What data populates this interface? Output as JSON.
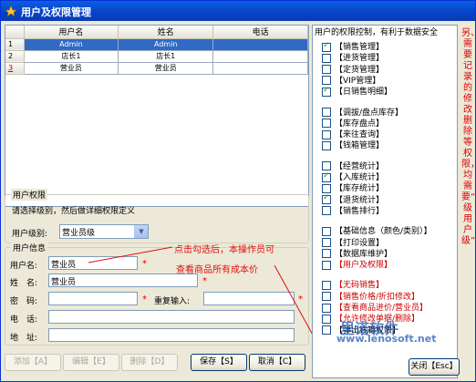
{
  "window": {
    "title": "用户及权限管理"
  },
  "grid": {
    "headers": [
      "用户名",
      "姓名",
      "电话"
    ],
    "rows": [
      {
        "num": "1",
        "username": "Admin",
        "name": "Admin",
        "phone": ""
      },
      {
        "num": "2",
        "username": "店长1",
        "name": "店长1",
        "phone": ""
      },
      {
        "num": "3",
        "username": "营业员",
        "name": "营业员",
        "phone": ""
      }
    ]
  },
  "perm_group": {
    "title": "用户权限",
    "hint": "请选择级别，然后做详细权限定义",
    "level_label": "用户级别:",
    "level_value": "营业员级"
  },
  "info_group": {
    "title": "用户信息",
    "username_label": "用户名:",
    "username_value": "营业员",
    "name_label": "姓　名:",
    "name_value": "营业员",
    "password_label": "密　码:",
    "password_value": "",
    "repeat_label": "重复输入:",
    "repeat_value": "",
    "phone_label": "电　话:",
    "phone_value": "",
    "address_label": "地　址:",
    "address_value": ""
  },
  "required_mark": "*",
  "annotation": {
    "line1": "点击勾选后，本操作员可",
    "line2": "查看商品所有成本价"
  },
  "buttons": {
    "add": "添加【A】",
    "edit": "编辑【E】",
    "delete": "删除【D】",
    "save": "保存【S】",
    "cancel": "取消【C】",
    "close": "关闭【Esc】"
  },
  "permissions": {
    "title": "用户的权限控制，有利于数据安全",
    "items": [
      {
        "label": "【销售管理】",
        "checked": true,
        "red": false
      },
      {
        "label": "【进货管理】",
        "checked": false,
        "red": false
      },
      {
        "label": "【定货管理】",
        "checked": false,
        "red": false
      },
      {
        "label": "【VIP管理】",
        "checked": false,
        "red": false
      },
      {
        "label": "【日销售明细】",
        "checked": true,
        "red": false
      },
      {
        "label": "【调拔/盘点库存】",
        "checked": false,
        "red": false
      },
      {
        "label": "【库存盘点】",
        "checked": false,
        "red": false
      },
      {
        "label": "【来往查询】",
        "checked": false,
        "red": false
      },
      {
        "label": "【钱箱管理】",
        "checked": false,
        "red": false
      },
      {
        "label": "【经营统计】",
        "checked": false,
        "red": false
      },
      {
        "label": "【入库统计】",
        "checked": true,
        "red": false
      },
      {
        "label": "【库存统计】",
        "checked": false,
        "red": false
      },
      {
        "label": "【退货统计】",
        "checked": true,
        "red": false
      },
      {
        "label": "【销售排行】",
        "checked": false,
        "red": false
      },
      {
        "label": "【基础信息（颜色/类别）】",
        "checked": false,
        "red": false
      },
      {
        "label": "【打印设置】",
        "checked": false,
        "red": false
      },
      {
        "label": "【数据库维护】",
        "checked": false,
        "red": false
      },
      {
        "label": "【用户及权限】",
        "checked": false,
        "red": true
      },
      {
        "label": "【无码销售】",
        "checked": false,
        "red": true
      },
      {
        "label": "【销售价格/折扣修改】",
        "checked": false,
        "red": true
      },
      {
        "label": "【查看商品进价/营业员】",
        "checked": false,
        "red": true
      },
      {
        "label": "【允许修改单据/删除】",
        "checked": false,
        "red": true
      },
      {
        "label": "【弹出钱箱权限】",
        "checked": false,
        "red": false
      }
    ]
  },
  "side_note": "另、需要记录的修改删除等权限，均需要“超级用户级”",
  "watermark": {
    "line1": "里诺软件",
    "line2": "www.lenosoft.net"
  }
}
